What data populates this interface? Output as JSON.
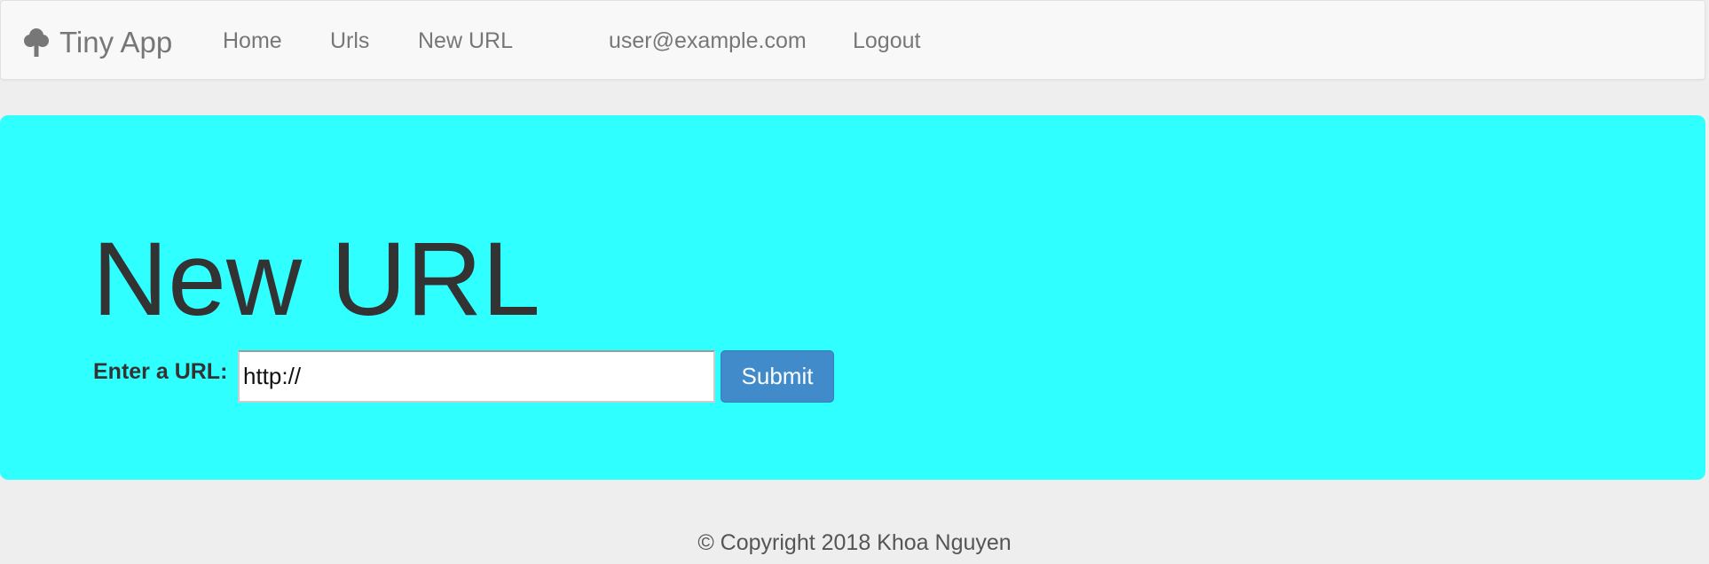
{
  "navbar": {
    "brand": "Tiny App",
    "brand_icon": "tree-icon",
    "links": {
      "home": "Home",
      "urls": "Urls",
      "new_url": "New URL"
    },
    "user_email": "user@example.com",
    "logout": "Logout"
  },
  "jumbotron": {
    "title": "New URL",
    "background_color": "#2fffff",
    "form": {
      "label": "Enter a URL:",
      "input_value": "http://",
      "submit_label": "Submit"
    }
  },
  "footer": {
    "text": "© Copyright 2018 Khoa Nguyen"
  }
}
